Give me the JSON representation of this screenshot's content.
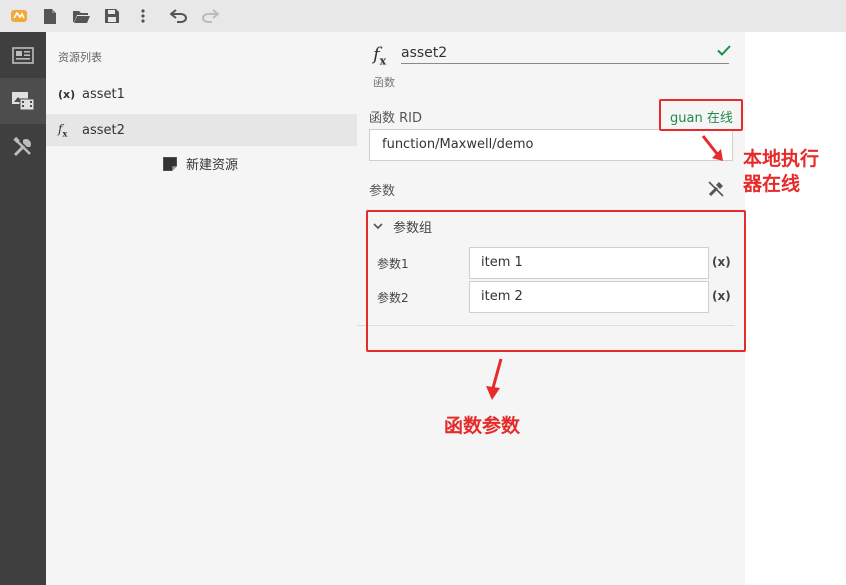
{
  "toolbar": {
    "buttons": [
      {
        "name": "app-logo",
        "icon": "logo-icon"
      },
      {
        "name": "new-file-button",
        "icon": "file-icon"
      },
      {
        "name": "open-folder-button",
        "icon": "folder-open-icon"
      },
      {
        "name": "save-button",
        "icon": "save-icon"
      },
      {
        "name": "more-button",
        "icon": "more-vertical-icon"
      },
      {
        "name": "undo-button",
        "icon": "undo-icon"
      },
      {
        "name": "redo-button",
        "icon": "redo-icon"
      }
    ]
  },
  "sidebar_rail": {
    "items": [
      {
        "name": "news-icon"
      },
      {
        "name": "media-icon"
      },
      {
        "name": "tools-icon"
      }
    ]
  },
  "resource_list": {
    "header": "资源列表",
    "items": [
      {
        "icon": "(x)",
        "label": "asset1",
        "selected": false
      },
      {
        "icon": "fx",
        "label": "asset2",
        "selected": true
      }
    ],
    "new_resource_label": "新建资源"
  },
  "editor": {
    "name_value": "asset2",
    "type_label": "函数",
    "rid_label": "函数 RID",
    "online_status": "guan 在线",
    "rid_value": "function/Maxwell/demo",
    "params_label": "参数",
    "group_label": "参数组",
    "params": [
      {
        "label": "参数1",
        "value": "item 1",
        "var_symbol": "(x)"
      },
      {
        "label": "参数2",
        "value": "item 2",
        "var_symbol": "(x)"
      }
    ]
  },
  "annotations": {
    "executor_note": [
      "本地执行",
      "器在线"
    ],
    "params_note": "函数参数",
    "color": "#e52b2b"
  },
  "colors": {
    "online_green": "#1f8a4c",
    "rail_dark": "#3f3f3f",
    "annotation_red": "#e52b2b"
  }
}
